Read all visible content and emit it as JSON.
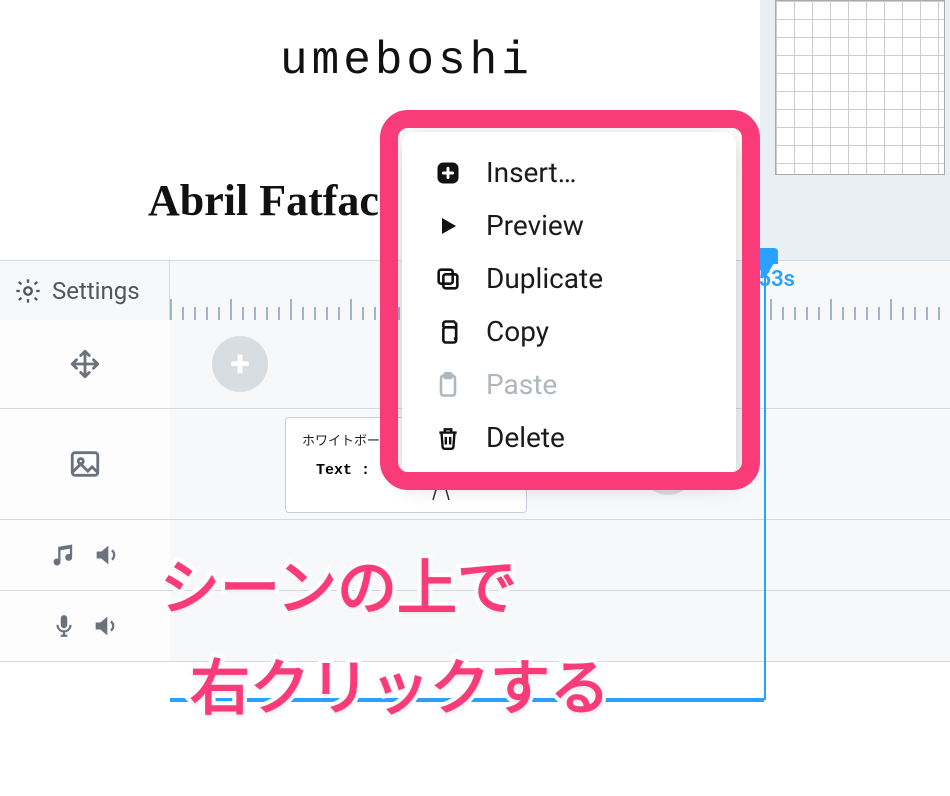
{
  "canvas": {
    "sample_text_1": "umeboshi",
    "sample_text_2": "Abril Fatface"
  },
  "timeline": {
    "settings_label": "Settings",
    "time_readout": "53s"
  },
  "scene_card": {
    "line1": "ホワイトボード",
    "line2": "Text :"
  },
  "context_menu": {
    "insert": "Insert…",
    "preview": "Preview",
    "duplicate": "Duplicate",
    "copy": "Copy",
    "paste": "Paste",
    "delete": "Delete"
  },
  "annotation": {
    "line1": "シーンの上で",
    "line2": "右クリックする"
  }
}
